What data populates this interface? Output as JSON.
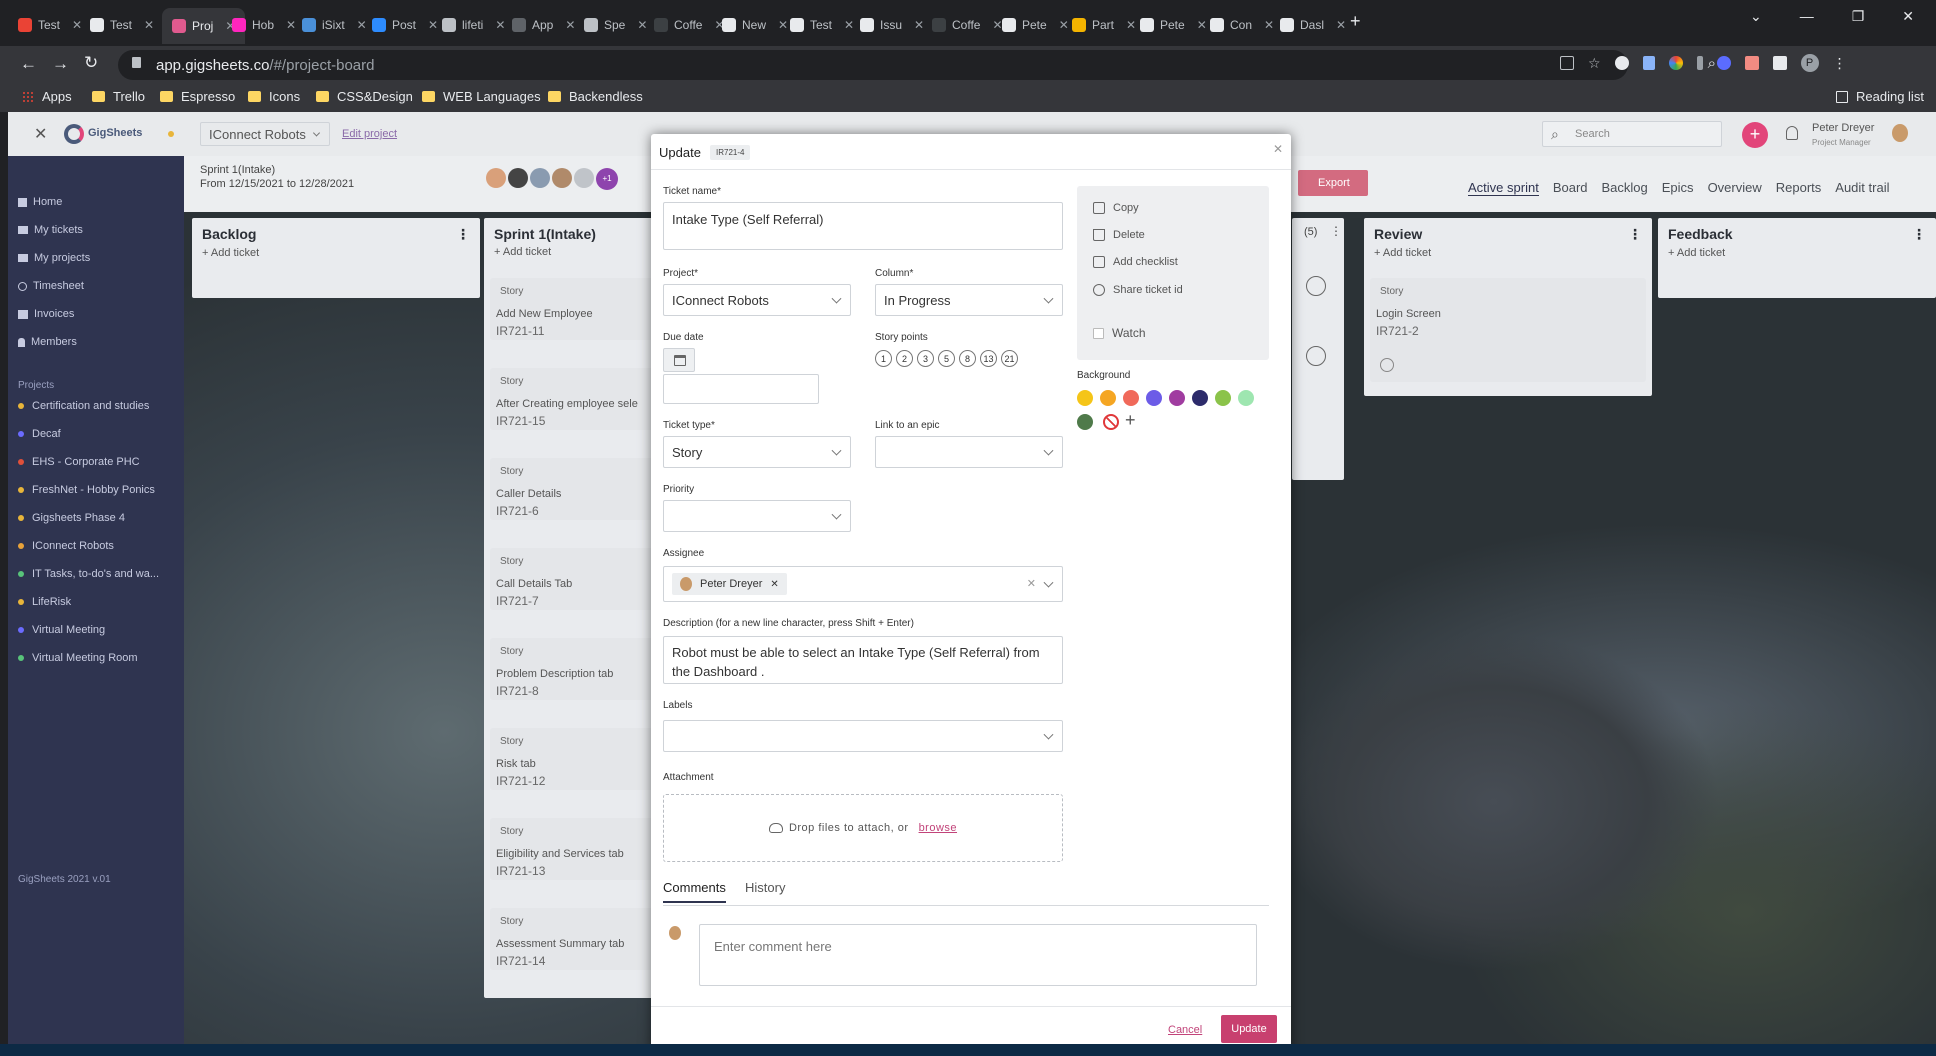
{
  "browser": {
    "tabs": [
      {
        "label": "Test",
        "color": "#ea4335",
        "icon": "gmail-icon"
      },
      {
        "label": "Test",
        "color": "#e8eaed",
        "icon": "github-icon"
      },
      {
        "label": "Proj",
        "color": "#e05a8e",
        "icon": "gigsheets-icon"
      },
      {
        "label": "Hob",
        "color": "#ff26be",
        "icon": "xd-icon"
      },
      {
        "label": "iSixt",
        "color": "#4a90d9",
        "icon": "isixt-icon"
      },
      {
        "label": "Post",
        "color": "#2d8cff",
        "icon": "zoom-icon"
      },
      {
        "label": "lifeti",
        "color": "#bdc1c6",
        "icon": "globe-icon"
      },
      {
        "label": "App",
        "color": "#5f6368",
        "icon": "app-icon"
      },
      {
        "label": "Spe",
        "color": "#bdc1c6",
        "icon": "spec-icon"
      },
      {
        "label": "Coffe",
        "color": "#3c4043",
        "icon": "coffee-icon"
      },
      {
        "label": "New",
        "color": "#e8eaed",
        "icon": "new-icon"
      },
      {
        "label": "Test",
        "color": "#e8eaed",
        "icon": "github-icon"
      },
      {
        "label": "Issu",
        "color": "#e8eaed",
        "icon": "github-icon"
      },
      {
        "label": "Coffe",
        "color": "#3c4043",
        "icon": "coffee-icon"
      },
      {
        "label": "Pete",
        "color": "#e8eaed",
        "icon": "github-icon"
      },
      {
        "label": "Part",
        "color": "#f4b400",
        "icon": "bolt-icon"
      },
      {
        "label": "Pete",
        "color": "#e8eaed",
        "icon": "github-icon"
      },
      {
        "label": "Con",
        "color": "#e8eaed",
        "icon": "github-icon"
      },
      {
        "label": "Dasl",
        "color": "#e8eaed",
        "icon": "dash-icon"
      }
    ],
    "url_host": "app.gigsheets.co",
    "url_path": "/#/project-board",
    "bookmarks": [
      "Apps",
      "Trello",
      "Espresso",
      "Icons",
      "CSS&Design",
      "WEB Languages",
      "Backendless"
    ],
    "reading_list": "Reading list"
  },
  "app": {
    "brand": "GigSheets",
    "project_select": "IConnect Robots",
    "edit_project": "Edit project",
    "search_placeholder": "Search",
    "user_name": "Peter Dreyer",
    "user_role": "Project Manager",
    "sprint_name": "Sprint 1(Intake)",
    "sprint_dates": "From 12/15/2021 to 12/28/2021",
    "avatar_extra": "+1",
    "export": "Export",
    "nav_tabs": [
      "Active sprint",
      "Board",
      "Backlog",
      "Epics",
      "Overview",
      "Reports",
      "Audit trail"
    ],
    "nav": [
      "Home",
      "My tickets",
      "My projects",
      "Timesheet",
      "Invoices",
      "Members"
    ],
    "projects_heading": "Projects",
    "projects": [
      {
        "name": "Certification and studies",
        "color": "#e8b53a"
      },
      {
        "name": "Decaf",
        "color": "#6b6bff"
      },
      {
        "name": "EHS - Corporate PHC",
        "color": "#e0503a"
      },
      {
        "name": "FreshNet - Hobby Ponics",
        "color": "#e8b53a"
      },
      {
        "name": "Gigsheets Phase 4",
        "color": "#e8b53a"
      },
      {
        "name": "IConnect Robots",
        "color": "#e8a23a"
      },
      {
        "name": "IT Tasks, to-do's and wa...",
        "color": "#58c47a"
      },
      {
        "name": "LifeRisk",
        "color": "#e8b53a"
      },
      {
        "name": "Virtual Meeting",
        "color": "#6b6bff"
      },
      {
        "name": "Virtual Meeting Room",
        "color": "#58c47a"
      }
    ],
    "version": "GigSheets 2021 v.01"
  },
  "board": {
    "columns": [
      {
        "title": "Backlog",
        "add": "+ Add ticket"
      },
      {
        "title": "Sprint 1(Intake)",
        "add": "+ Add ticket"
      },
      {
        "title": "Review",
        "add": "+ Add ticket"
      },
      {
        "title": "Feedback",
        "add": "+ Add ticket"
      }
    ],
    "hidden_col_count": "(5)",
    "sprint_cards": [
      {
        "kind": "Story",
        "title": "Add New Employee",
        "id": "IR721-11"
      },
      {
        "kind": "Story",
        "title": "After Creating employee sele",
        "id": "IR721-15"
      },
      {
        "kind": "Story",
        "title": "Caller Details",
        "id": "IR721-6"
      },
      {
        "kind": "Story",
        "title": "Call Details Tab",
        "id": "IR721-7"
      },
      {
        "kind": "Story",
        "title": "Problem Description tab",
        "id": "IR721-8"
      },
      {
        "kind": "Story",
        "title": "Risk tab",
        "id": "IR721-12"
      },
      {
        "kind": "Story",
        "title": "Eligibility and Services tab",
        "id": "IR721-13"
      },
      {
        "kind": "Story",
        "title": "Assessment Summary tab",
        "id": "IR721-14"
      }
    ],
    "review_card": {
      "kind": "Story",
      "title": "Login Screen",
      "id": "IR721-2"
    }
  },
  "modal": {
    "title": "Update",
    "ticket_code": "IR721-4",
    "ticket_name_label": "Ticket name*",
    "ticket_name": "Intake Type (Self Referral)",
    "project_label": "Project*",
    "project": "IConnect Robots",
    "column_label": "Column*",
    "column": "In Progress",
    "due_label": "Due date",
    "story_points_label": "Story points",
    "story_points": [
      "1",
      "2",
      "3",
      "5",
      "8",
      "13",
      "21"
    ],
    "ticket_type_label": "Ticket type*",
    "ticket_type": "Story",
    "epic_label": "Link to an epic",
    "priority_label": "Priority",
    "assignee_label": "Assignee",
    "assignee": "Peter Dreyer",
    "description_label": "Description (for a new line character, press Shift + Enter)",
    "description": "Robot must be able to select an Intake Type (Self Referral) from the Dashboard .",
    "labels_label": "Labels",
    "attachment_label": "Attachment",
    "drop_text": "Drop files to attach, or",
    "browse": "browse",
    "side_actions": [
      "Copy",
      "Delete",
      "Add checklist",
      "Share ticket id"
    ],
    "watch": "Watch",
    "background_label": "Background",
    "bg_colors": [
      "#f5c518",
      "#f5a623",
      "#f0695a",
      "#6c5ce7",
      "#a03ca0",
      "#2d2b6b",
      "#8bc34a",
      "#9ee6b0",
      "#4f7a4a"
    ],
    "tabs": [
      "Comments",
      "History"
    ],
    "comment_placeholder": "Enter comment here",
    "cancel": "Cancel",
    "update": "Update"
  }
}
